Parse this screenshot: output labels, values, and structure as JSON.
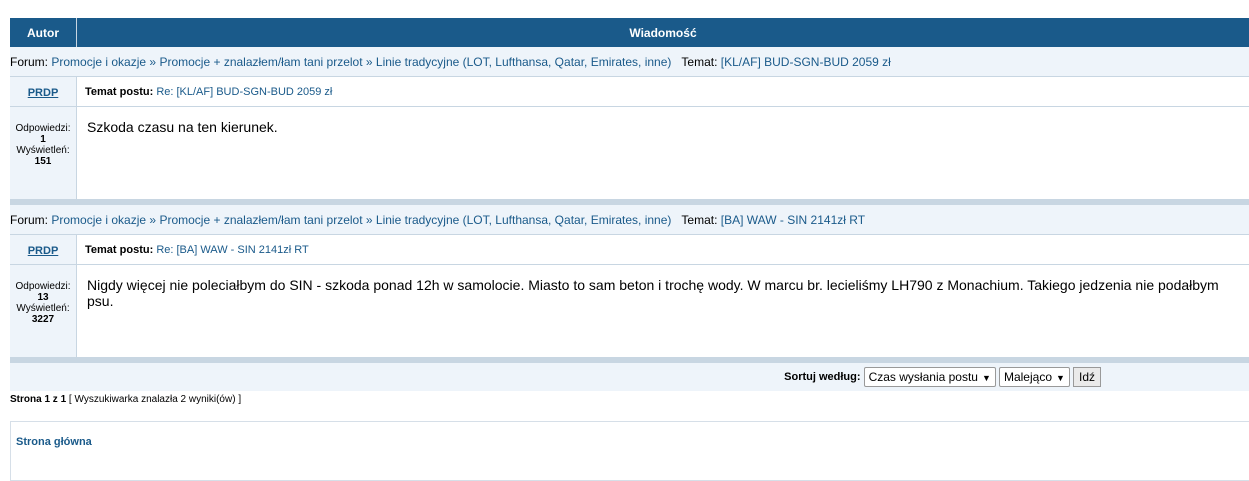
{
  "header": {
    "author_label": "Autor",
    "message_label": "Wiadomość"
  },
  "posts": [
    {
      "forum_prefix": "Forum:",
      "forum_crumbs": [
        "Promocje i okazje",
        "Promocje + znalazłem/łam tani przelot",
        "Linie tradycyjne (LOT, Lufthansa, Qatar, Emirates, inne)"
      ],
      "crumb_sep": "»",
      "topic_prefix": "Temat:",
      "topic": "[KL/AF] BUD-SGN-BUD 2059 zł",
      "author": "PRDP",
      "subject_prefix": "Temat postu:",
      "subject": "Re: [KL/AF] BUD-SGN-BUD 2059 zł",
      "replies_label": "Odpowiedzi:",
      "replies": "1",
      "views_label": "Wyświetleń:",
      "views": "151",
      "body": "Szkoda czasu na ten kierunek."
    },
    {
      "forum_prefix": "Forum:",
      "forum_crumbs": [
        "Promocje i okazje",
        "Promocje + znalazłem/łam tani przelot",
        "Linie tradycyjne (LOT, Lufthansa, Qatar, Emirates, inne)"
      ],
      "crumb_sep": "»",
      "topic_prefix": "Temat:",
      "topic": "[BA] WAW - SIN 2141zł RT",
      "author": "PRDP",
      "subject_prefix": "Temat postu:",
      "subject": "Re: [BA] WAW - SIN 2141zł RT",
      "replies_label": "Odpowiedzi:",
      "replies": "13",
      "views_label": "Wyświetleń:",
      "views": "3227",
      "body": "Nigdy więcej nie poleciałbym do SIN - szkoda ponad 12h w samolocie. Miasto to sam beton i trochę wody. W marcu br. lecieliśmy LH790 z Monachium. Takiego jedzenia nie podałbym psu."
    }
  ],
  "sort": {
    "label": "Sortuj według:",
    "field": "Czas wysłania postu",
    "order": "Malejąco",
    "go": "Idź"
  },
  "pagination": {
    "page": "Strona 1 z 1",
    "results": "[ Wyszukiwarka znalazła 2 wyniki(ów) ]"
  },
  "footer": {
    "home_link": "Strona główna"
  },
  "colors": {
    "header_bg": "#1a5a8a",
    "row_bg": "#eef4fa",
    "link": "#1a5a8a",
    "separator": "#c8d6e2"
  }
}
